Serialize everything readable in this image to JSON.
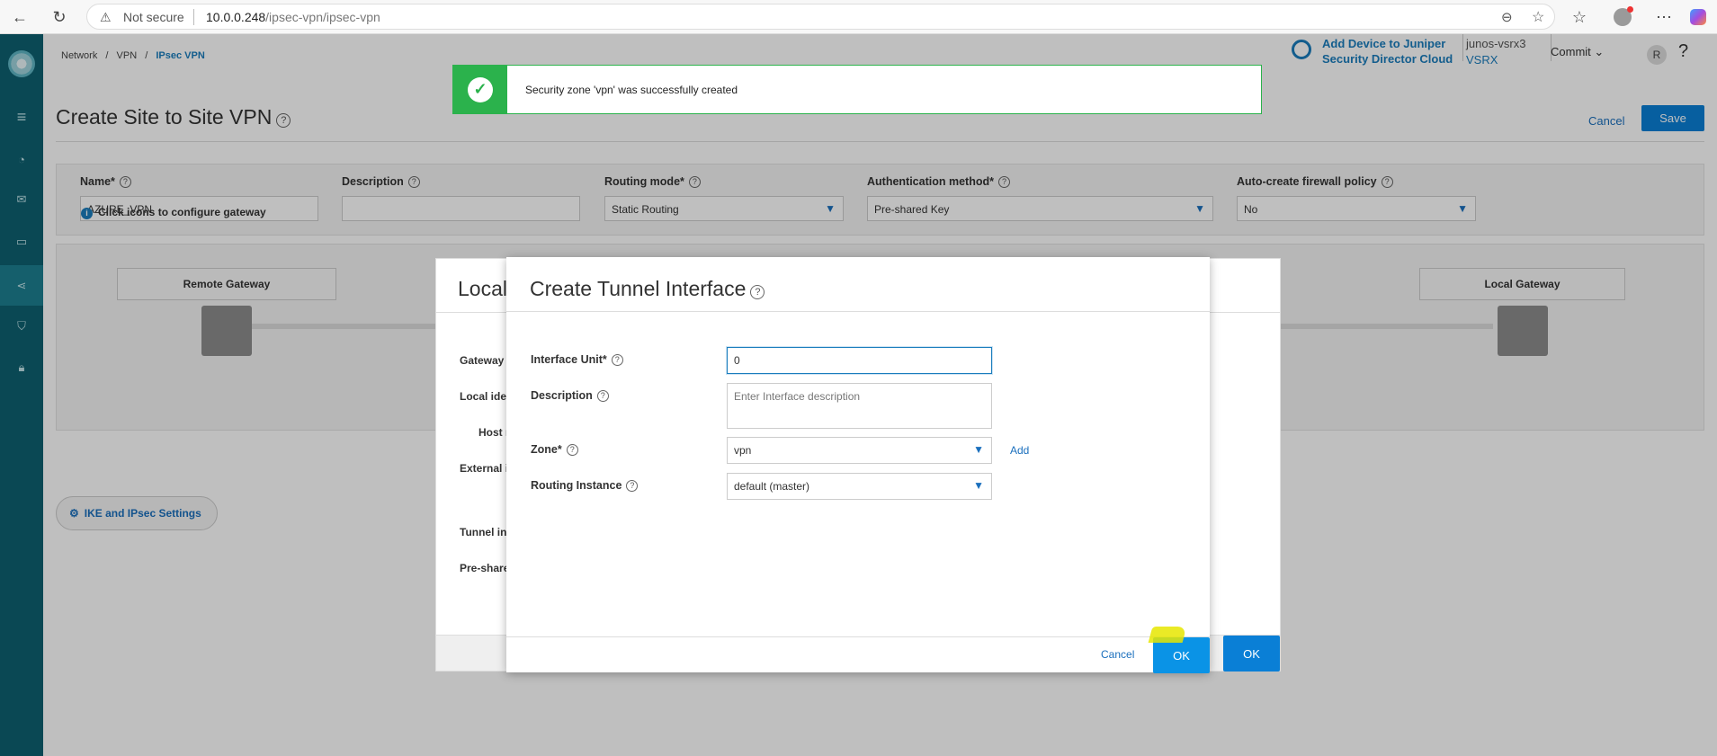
{
  "browser": {
    "not_secure": "Not secure",
    "url_host": "10.0.0.248",
    "url_path": "/ipsec-vpn/ipsec-vpn"
  },
  "breadcrumb": {
    "network": "Network",
    "vpn": "VPN",
    "current": "IPsec VPN",
    "sep": "/"
  },
  "header": {
    "add_device_line1": "Add Device to Juniper",
    "add_device_line2": "Security Director Cloud",
    "device_name": "junos-vsrx3",
    "device_type": "VSRX",
    "commit": "Commit",
    "avatar": "R",
    "help": "?"
  },
  "page": {
    "title": "Create Site to Site VPN",
    "cancel": "Cancel",
    "save": "Save"
  },
  "form": {
    "name_label": "Name*",
    "name_value": "AZURE_VPN",
    "description_label": "Description",
    "description_value": "",
    "routing_label": "Routing mode*",
    "routing_value": "Static Routing",
    "auth_label": "Authentication method*",
    "auth_value": "Pre-shared Key",
    "firewall_label": "Auto-create firewall policy",
    "firewall_value": "No"
  },
  "gateway": {
    "hint": "Click icons to configure gateway",
    "remote": "Remote Gateway",
    "local": "Local Gateway"
  },
  "ike_button": "IKE and IPsec Settings",
  "toast": {
    "message": "Security zone 'vpn' was successfully created"
  },
  "back_dialog": {
    "title": "Local",
    "rows": [
      "Gateway",
      "Local ide",
      "Host r",
      "External i",
      "Tunnel in",
      "Pre-share"
    ],
    "ok": "OK"
  },
  "dialog": {
    "title": "Create Tunnel Interface",
    "unit_label": "Interface Unit*",
    "unit_value": "0",
    "desc_label": "Description",
    "desc_placeholder": "Enter Interface description",
    "zone_label": "Zone*",
    "zone_value": "vpn",
    "add": "Add",
    "ri_label": "Routing Instance",
    "ri_value": "default (master)",
    "cancel": "Cancel",
    "ok": "OK"
  },
  "colors": {
    "sidebar": "#0e6070",
    "primary": "#0a7fd6",
    "success": "#2bb24c",
    "link": "#1a6fbd"
  }
}
